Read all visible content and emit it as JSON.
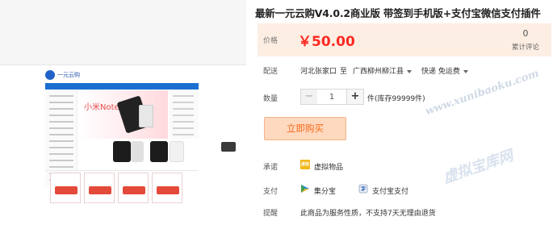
{
  "product": {
    "title": "最新一元云购V4.0.2商业版 带签到手机版+支付宝微信支付插件"
  },
  "price": {
    "label": "价格",
    "value": "￥50.00",
    "review_count": "0",
    "review_label": "累计评论",
    "accent_color": "#ff2a24",
    "box_color": "#fdeee3"
  },
  "delivery": {
    "label": "配送",
    "from": "河北张家口",
    "to_word": "至",
    "destination": "广西柳州柳江县",
    "shipping": "快递 免运费"
  },
  "quantity": {
    "label": "数量",
    "minus": "−",
    "value": "1",
    "plus": "+",
    "stock": "件(库存99999件)"
  },
  "buy_button": {
    "label": "立即购买"
  },
  "promise": {
    "label": "承诺",
    "icon_text": "虚拟",
    "text": "虚拟物品"
  },
  "payment": {
    "label": "支付",
    "method1": "集分宝",
    "method2": "支付宝支付"
  },
  "notice": {
    "label": "提醒",
    "text": "此商品为服务性质，不支持7天无理由退货"
  },
  "preview_image": {
    "logo_text": "一元云购",
    "banner_text": "小米Note"
  },
  "watermark": {
    "url": "www.xunibaoku.com",
    "name": "虚拟宝库网"
  }
}
